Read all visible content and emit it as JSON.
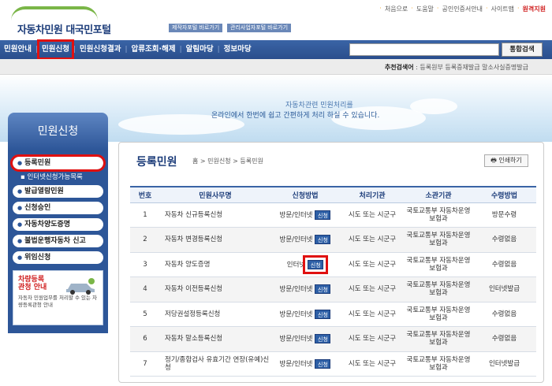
{
  "logo": {
    "text": "자동차민원 대국민포털"
  },
  "top_buttons": [
    "제작자포털 바로가기",
    "관리사업자포털 바로가기"
  ],
  "top_links": [
    "처음으로",
    "도움말",
    "공인인증서안내",
    "사이트맵",
    "원격지원"
  ],
  "nav": [
    "민원안내",
    "민원신청",
    "민원신청결과",
    "압류조회·해제",
    "알림마당",
    "정보마당"
  ],
  "search": {
    "placeholder": "",
    "button": "통합검색"
  },
  "recommend": {
    "label": "추천검색어",
    "items": "등록원부 등록증재발급 말소사실증명발급"
  },
  "banner": {
    "line1": "자동차관련 민원처리를",
    "line2": "온라인에서 한번에 쉽고 간편하게 처리 하실 수 있습니다."
  },
  "sidebar": {
    "title": "민원신청",
    "items": [
      {
        "label": "등록민원"
      },
      {
        "label": "발급열람민원"
      },
      {
        "label": "신청승인"
      },
      {
        "label": "자동차양도증명"
      },
      {
        "label": "불법운행자동차 신고"
      },
      {
        "label": "위임신청"
      }
    ],
    "sub": "인터넷신청가능목록",
    "box_title1": "차량등록",
    "box_title2": "관청 안내",
    "box_desc": "자동차 민원업무를 처리할 수 있는 차량등록관청 안내"
  },
  "page": {
    "title": "등록민원",
    "breadcrumb": "홈 > 민원신청 > 등록민원",
    "print": "인쇄하기"
  },
  "table": {
    "headers": [
      "번호",
      "민원사무명",
      "신청방법",
      "처리기관",
      "소관기관",
      "수령방법"
    ],
    "rows": [
      {
        "no": "1",
        "name": "자동차 신규등록신청",
        "method": "방문/인터넷",
        "btn": "신청",
        "proc": "시도 또는 시군구",
        "org": "국토교통부 자동차운영보험과",
        "recv": "방문수령"
      },
      {
        "no": "2",
        "name": "자동차 변경등록신청",
        "method": "방문/인터넷",
        "btn": "신청",
        "proc": "시도 또는 시군구",
        "org": "국토교통부 자동차운영보험과",
        "recv": "수령없음"
      },
      {
        "no": "3",
        "name": "자동차 양도증명",
        "method": "인터넷",
        "btn": "신청",
        "proc": "시도 또는 시군구",
        "org": "국토교통부 자동차운영보험과",
        "recv": "수령없음"
      },
      {
        "no": "4",
        "name": "자동차 이전등록신청",
        "method": "방문/인터넷",
        "btn": "신청",
        "proc": "시도 또는 시군구",
        "org": "국토교통부 자동차운영보험과",
        "recv": "인터넷발급"
      },
      {
        "no": "5",
        "name": "저당권설정등록신청",
        "method": "방문/인터넷",
        "btn": "신청",
        "proc": "시도 또는 시군구",
        "org": "국토교통부 자동차운영보험과",
        "recv": "수령없음"
      },
      {
        "no": "6",
        "name": "자동차 말소등록신청",
        "method": "방문/인터넷",
        "btn": "신청",
        "proc": "시도 또는 시군구",
        "org": "국토교통부 자동차운영보험과",
        "recv": "수령없음"
      },
      {
        "no": "7",
        "name": "정기/종합검사 유효기간 연장(유예)신청",
        "method": "방문/인터넷",
        "btn": "신청",
        "proc": "시도 또는 시군구",
        "org": "국토교통부 자동차운영보험과",
        "recv": "인터넷발급"
      }
    ]
  }
}
